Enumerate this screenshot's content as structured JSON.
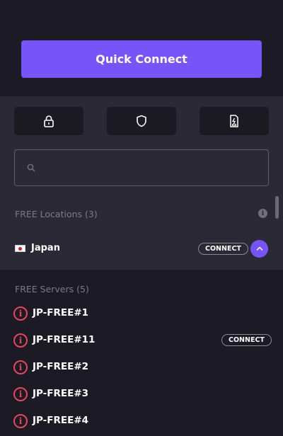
{
  "header": {
    "quick_connect_label": "Quick Connect"
  },
  "toolbar": {
    "buttons": [
      {
        "icon": "lock-icon"
      },
      {
        "icon": "shield-icon"
      },
      {
        "icon": "sim-card-icon"
      }
    ]
  },
  "search": {
    "placeholder": "",
    "value": ""
  },
  "locations": {
    "section_label": "FREE Locations (3)",
    "items": [
      {
        "name": "Japan",
        "flag": "japan-flag",
        "connect_label": "CONNECT"
      }
    ]
  },
  "servers": {
    "section_label": "FREE Servers (5)",
    "items": [
      {
        "name": "JP-FREE#1",
        "connect_label": ""
      },
      {
        "name": "JP-FREE#11",
        "connect_label": "CONNECT"
      },
      {
        "name": "JP-FREE#2",
        "connect_label": ""
      },
      {
        "name": "JP-FREE#3",
        "connect_label": ""
      },
      {
        "name": "JP-FREE#4",
        "connect_label": ""
      }
    ]
  },
  "colors": {
    "accent": "#7654f7",
    "background": "#1c1b25",
    "panel": "#2a2935",
    "warning": "#e8455d"
  }
}
